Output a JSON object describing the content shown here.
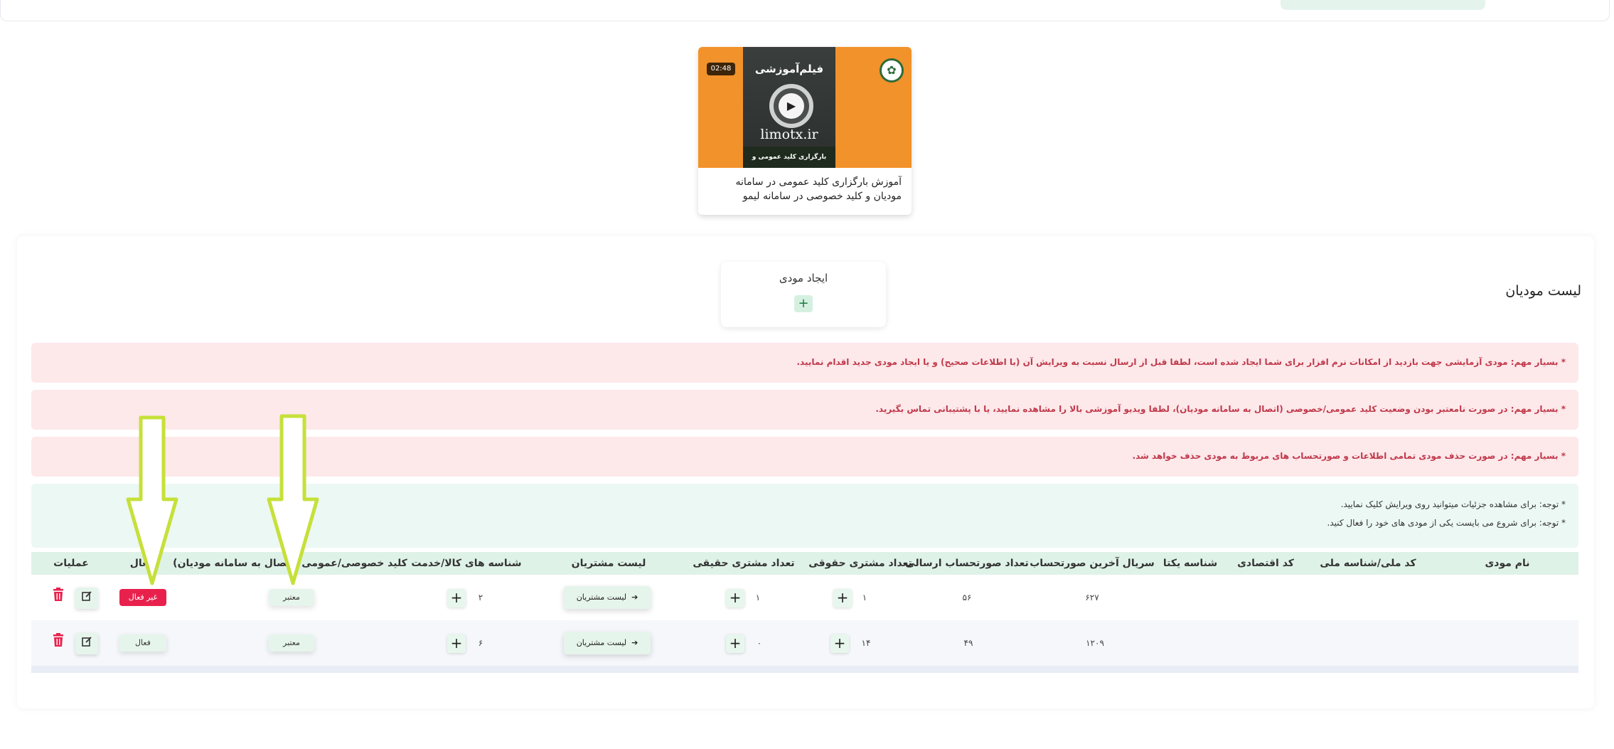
{
  "video": {
    "duration": "02:48",
    "thumb_title": "فیلم‌آموزشی",
    "thumb_site": "limotx.ir",
    "thumb_caption": "بارگزاری کلید عمومی و خصوصی در سامانه مودیان",
    "caption": "آموزش بارگزاری کلید عمومی در سامانه مودیان و کلید خصوصی در سامانه لیمو"
  },
  "panel": {
    "title": "لیست مودیان",
    "create_label": "ایجاد مودی",
    "create_button": "+"
  },
  "alerts": [
    "* بسیار مهم: مودی آزمایشی جهت بازدید از امکانات نرم افزار برای شما ایجاد شده است، لطفا قبل از ارسال نسبت به ویرایش آن (با اطلاعات صحیح) و یا ایجاد مودی جدید اقدام نمایید.",
    "* بسیار مهم: در صورت نامعتبر بودن وضعیت کلید عمومی/خصوصی (اتصال به سامانه مودیان)، لطفا ویدیو آموزشی بالا را مشاهده نمایید، یا با پشتیبانی تماس بگیرید.",
    "* بسیار مهم: در صورت حذف مودی تمامی اطلاعات و صورتحساب های مربوط به مودی حذف خواهد شد."
  ],
  "notes": [
    "* توجه: برای مشاهده جزئیات میتوانید روی ویرایش کلیک نمایید.",
    "* توجه: برای شروع می بایست یکی از مودی های خود را فعال کنید."
  ],
  "table": {
    "headers": {
      "name": "نام مودی",
      "national_id": "کد ملی/شناسه ملی",
      "economic_code": "کد اقتصادی",
      "unique_id": "شناسه یکتا",
      "last_serial": "سریال آخرین صورتحساب",
      "sent_count": "تعداد صورتحساب ارسالی",
      "legal_customers": "تعداد مشتری حقوقی",
      "real_customers": "تعداد مشتری حقیقی",
      "customer_list": "لیست مشتریان",
      "product_ids": "شناسه های کالا/خدمت",
      "keys": "کلید خصوصی/عمومی (اتصال به سامانه مودیان)",
      "active": "فعال",
      "operations": "عملیات"
    },
    "customer_list_label": "لیست مشتریان",
    "rows": [
      {
        "last_serial": "۶۲۷",
        "sent_count": "۵۶",
        "legal_customers": "۱",
        "real_customers": "۱",
        "product_ids": "۲",
        "key_status": "معتبر",
        "active_status": "غیر فعال",
        "is_active": false
      },
      {
        "last_serial": "۱۲۰۹",
        "sent_count": "۴۹",
        "legal_customers": "۱۴",
        "real_customers": "۰",
        "product_ids": "۶",
        "key_status": "معتبر",
        "active_status": "فعال",
        "is_active": true
      }
    ]
  },
  "colors": {
    "header_bg": "#dff2e8",
    "alert_red_bg": "#fde8ea",
    "alert_red_text": "#c0394a",
    "inactive_badge": "#e8214c",
    "annotation_arrow": "#c6e03a"
  }
}
